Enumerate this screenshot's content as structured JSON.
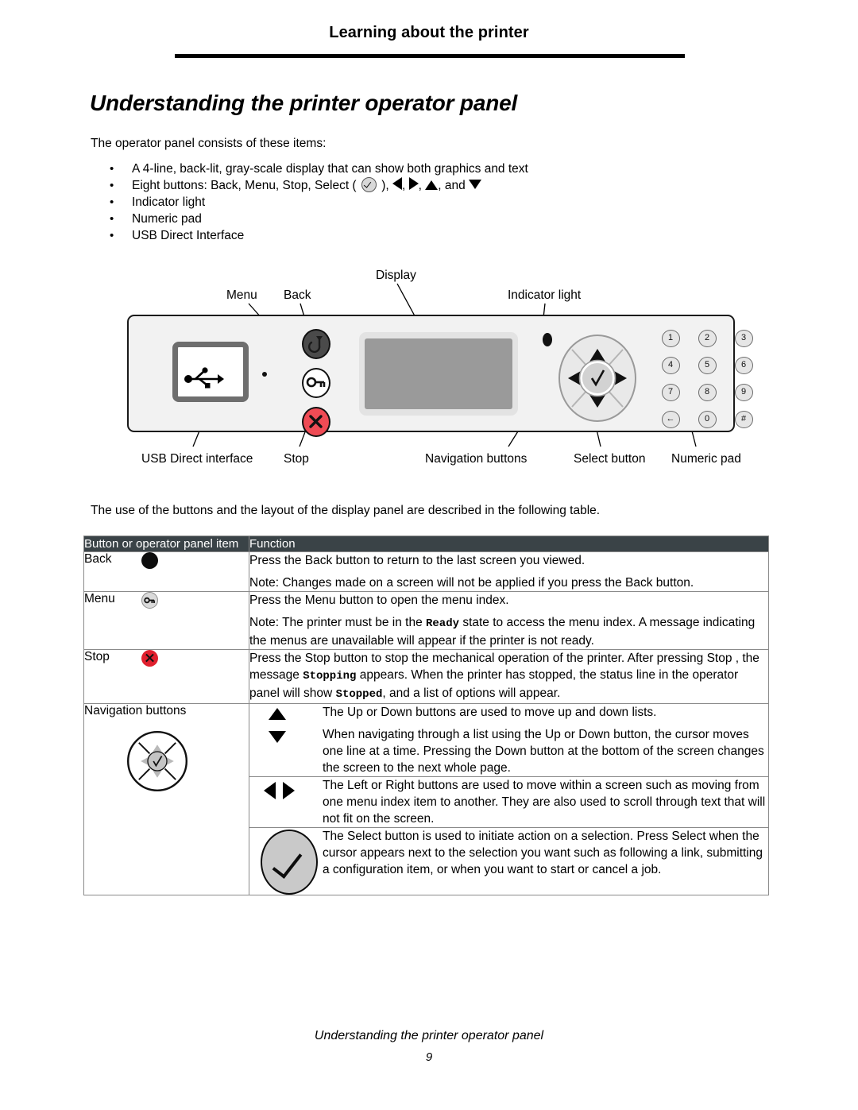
{
  "header": {
    "running_head": "Learning about the printer"
  },
  "title": "Understanding the printer operator panel",
  "intro": "The operator panel consists of these items:",
  "bullets": [
    {
      "marker": "•",
      "text_before": "A 4-line, back-lit, gray-scale display that can show both graphics and text",
      "text_after": ""
    },
    {
      "marker": "•",
      "text_before": "Eight buttons: Back, Menu, Stop, Select (",
      "text_after": "),"
    },
    {
      "marker": "•",
      "text_before": "Indicator light",
      "text_after": ""
    },
    {
      "marker": "•",
      "text_before": "Numeric pad",
      "text_after": ""
    },
    {
      "marker": "•",
      "text_before": "USB Direct Interface",
      "text_after": ""
    }
  ],
  "bullet_tail": {
    "comma1": ",",
    "comma2": ",",
    "and": ", and"
  },
  "diagram": {
    "labels_top": [
      {
        "name": "menu",
        "text": "Menu"
      },
      {
        "name": "back",
        "text": "Back"
      },
      {
        "name": "display",
        "text": "Display"
      },
      {
        "name": "indicator-light",
        "text": "Indicator light"
      }
    ],
    "labels_bottom": [
      {
        "name": "usb-direct-interface",
        "text": "USB Direct interface"
      },
      {
        "name": "stop",
        "text": "Stop"
      },
      {
        "name": "navigation-buttons",
        "text": "Navigation buttons"
      },
      {
        "name": "select-button",
        "text": "Select button"
      },
      {
        "name": "numeric-pad",
        "text": "Numeric pad"
      }
    ],
    "numeric_keys": [
      "1",
      "2",
      "3",
      "4",
      "5",
      "6",
      "7",
      "8",
      "9",
      "←",
      "0",
      "#"
    ],
    "colors": {
      "panel_face": "#f2f2f2",
      "stop_button": "#ef4b55",
      "back_button": "#4a4a4a",
      "lcd_screen": "#9a9a9a"
    }
  },
  "table_intro": "The use of the buttons and the layout of the display panel are described in the following table.",
  "table": {
    "header": {
      "col1": "Button or operator panel item",
      "col2": "Function"
    },
    "rows": [
      {
        "label": "Back",
        "icon": "back-dot-icon",
        "paragraphs": [
          "Press the Back button to return to the last screen you viewed.",
          "Note: Changes made on a screen will not be applied if you press the Back button."
        ]
      },
      {
        "label": "Menu",
        "icon": "menu-key-icon",
        "paragraphs": [
          "Press the Menu button to open the menu index.",
          "Note: The printer must be in the Ready state to access the menu index. A message indicating the menus are unavailable will appear if the printer is not ready."
        ],
        "mono_terms": [
          "Ready"
        ]
      },
      {
        "label": "Stop",
        "icon": "stop-x-icon",
        "paragraphs": [
          "Press the Stop button to stop the mechanical operation of the printer. After pressing Stop , the message Stopping appears. When the printer has stopped, the status line in the operator panel will show Stopped, and a list of options will appear."
        ],
        "mono_terms": [
          "Stopping",
          "Stopped"
        ]
      },
      {
        "label": "Navigation buttons",
        "icon": "nav-pad-icon",
        "subrows": [
          {
            "glyph": "up-down-arrow-icon",
            "paragraphs": [
              "The Up or Down buttons are used to move up and down lists.",
              "When navigating through a list using the Up or Down button, the cursor moves one line at a time. Pressing the Down button at the bottom of the screen changes the screen to the next whole page."
            ]
          },
          {
            "glyph": "left-right-arrow-icon",
            "paragraphs": [
              "The Left or Right buttons are used to move within a screen such as moving from one menu index item to another. They are also used to scroll through text that will not fit on the screen."
            ]
          },
          {
            "glyph": "select-check-icon",
            "paragraphs": [
              "The Select button is used to initiate action on a selection. Press Select when the cursor appears next to the selection you want such as following a link, submitting a configuration item, or when you want to start or cancel a job."
            ]
          }
        ]
      }
    ],
    "colors": {
      "header_bg": "#3a4347",
      "border": "#8a8a8a"
    }
  },
  "footer": {
    "title": "Understanding the printer operator panel",
    "page_number": "9"
  }
}
